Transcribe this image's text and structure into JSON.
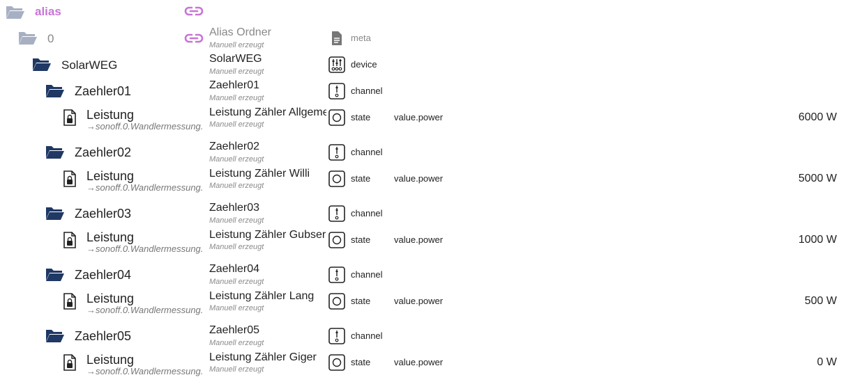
{
  "colors": {
    "folder_light": "#a7b0c3",
    "folder_dark": "#1f3864",
    "alias_accent": "#c875d6",
    "muted": "#888888"
  },
  "tree": {
    "root": {
      "label": "alias",
      "link_icon": "link-icon"
    },
    "level0": {
      "label": "0",
      "link_icon": "link-icon",
      "name": "Alias Ordner",
      "note": "Manuell erzeugt",
      "type": "meta",
      "type_icon": "file-icon"
    },
    "device": {
      "label": "SolarWEG",
      "name": "SolarWEG",
      "note": "Manuell erzeugt",
      "type": "device",
      "type_icon": "device-icon"
    },
    "channels": [
      {
        "label": "Zaehler01",
        "name": "Zaehler01",
        "note": "Manuell erzeugt",
        "type": "channel",
        "state": {
          "label": "Leistung",
          "target": "→sonoff.0.Wandlermessung.",
          "name": "Leistung Zähler Allgemein",
          "note": "Manuell erzeugt",
          "type": "state",
          "role": "value.power",
          "value": "6000 W"
        }
      },
      {
        "label": "Zaehler02",
        "name": "Zaehler02",
        "note": "Manuell erzeugt",
        "type": "channel",
        "state": {
          "label": "Leistung",
          "target": "→sonoff.0.Wandlermessung.",
          "name": "Leistung Zähler Willi",
          "note": "Manuell erzeugt",
          "type": "state",
          "role": "value.power",
          "value": "5000 W"
        }
      },
      {
        "label": "Zaehler03",
        "name": "Zaehler03",
        "note": "Manuell erzeugt",
        "type": "channel",
        "state": {
          "label": "Leistung",
          "target": "→sonoff.0.Wandlermessung.",
          "name": "Leistung Zähler Gubser",
          "note": "Manuell erzeugt",
          "type": "state",
          "role": "value.power",
          "value": "1000 W"
        }
      },
      {
        "label": "Zaehler04",
        "name": "Zaehler04",
        "note": "Manuell erzeugt",
        "type": "channel",
        "state": {
          "label": "Leistung",
          "target": "→sonoff.0.Wandlermessung.",
          "name": "Leistung Zähler Lang",
          "note": "Manuell erzeugt",
          "type": "state",
          "role": "value.power",
          "value": "500 W"
        }
      },
      {
        "label": "Zaehler05",
        "name": "Zaehler05",
        "note": "Manuell erzeugt",
        "type": "channel",
        "state": {
          "label": "Leistung",
          "target": "→sonoff.0.Wandlermessung.",
          "name": "Leistung Zähler Giger",
          "note": "Manuell erzeugt",
          "type": "state",
          "role": "value.power",
          "value": "0 W"
        }
      }
    ]
  }
}
